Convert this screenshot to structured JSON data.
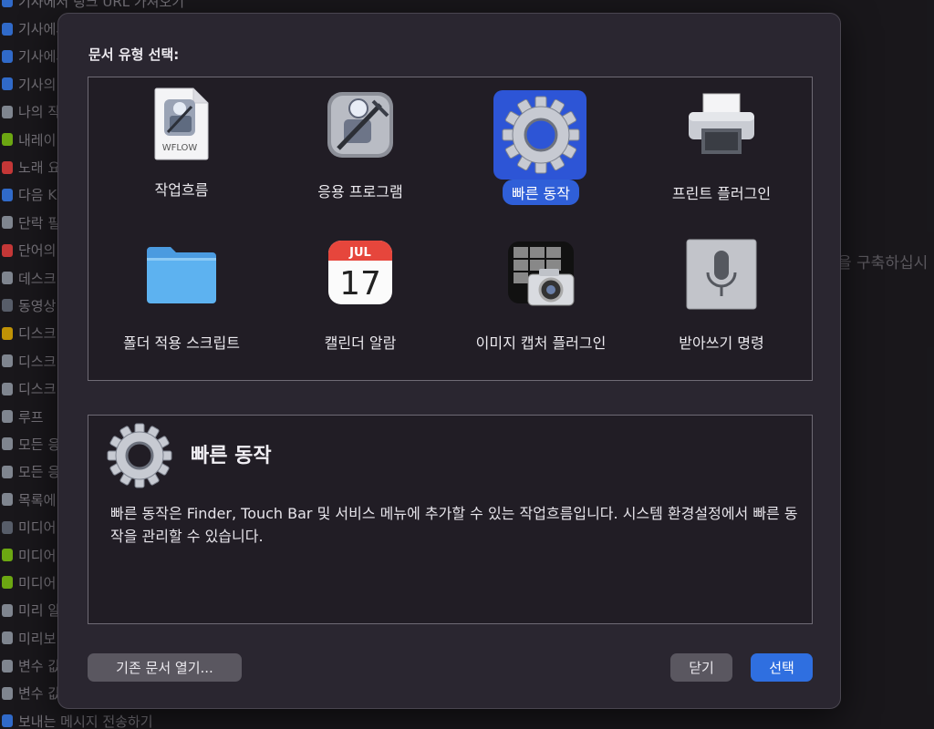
{
  "background": {
    "sidebar_items": [
      {
        "label": "기사에서 링크 URL 가져오기",
        "color": "#3b82f6"
      },
      {
        "label": "기사에서",
        "color": "#3b82f6"
      },
      {
        "label": "기사에서",
        "color": "#3b82f6"
      },
      {
        "label": "기사의",
        "color": "#3b82f6"
      },
      {
        "label": "나의 작",
        "color": "#9ca3af"
      },
      {
        "label": "내레이",
        "color": "#84cc16"
      },
      {
        "label": "노래 요",
        "color": "#ef4444"
      },
      {
        "label": "다음 K",
        "color": "#3b82f6"
      },
      {
        "label": "단락 필",
        "color": "#9ca3af"
      },
      {
        "label": "단어의",
        "color": "#ef4444"
      },
      {
        "label": "데스크",
        "color": "#9ca3af"
      },
      {
        "label": "동영상",
        "color": "#6b7280"
      },
      {
        "label": "디스크",
        "color": "#eab308"
      },
      {
        "label": "디스크",
        "color": "#9ca3af"
      },
      {
        "label": "디스크",
        "color": "#9ca3af"
      },
      {
        "label": "루프",
        "color": "#9ca3af"
      },
      {
        "label": "모든 응",
        "color": "#9ca3af"
      },
      {
        "label": "모든 응",
        "color": "#9ca3af"
      },
      {
        "label": "목록에",
        "color": "#9ca3af"
      },
      {
        "label": "미디어",
        "color": "#6b7280"
      },
      {
        "label": "미디어",
        "color": "#84cc16"
      },
      {
        "label": "미디어",
        "color": "#84cc16"
      },
      {
        "label": "미리 알",
        "color": "#9ca3af"
      },
      {
        "label": "미리보",
        "color": "#9ca3af"
      },
      {
        "label": "변수 값",
        "color": "#9ca3af"
      },
      {
        "label": "변수 값",
        "color": "#9ca3af"
      },
      {
        "label": "보내는 메시지 전송하기",
        "color": "#3b82f6"
      }
    ],
    "right_text": "을 구축하십시"
  },
  "dialog": {
    "title": "문서 유형 선택:",
    "types": [
      {
        "label": "작업흐름",
        "icon": "workflow-document-icon",
        "icon_text": "WFLOW"
      },
      {
        "label": "응용 프로그램",
        "icon": "automator-robot-icon"
      },
      {
        "label": "빠른 동작",
        "icon": "gear-icon"
      },
      {
        "label": "프린트 플러그인",
        "icon": "printer-icon"
      },
      {
        "label": "폴더 적용 스크립트",
        "icon": "folder-icon"
      },
      {
        "label": "캘린더 알람",
        "icon": "calendar-icon",
        "month": "JUL",
        "day": "17"
      },
      {
        "label": "이미지 캡처 플러그인",
        "icon": "image-capture-icon"
      },
      {
        "label": "받아쓰기 명령",
        "icon": "microphone-icon"
      }
    ],
    "selected_index": 2,
    "description": {
      "title": "빠른 동작",
      "text": "빠른 동작은 Finder, Touch Bar 및 서비스 메뉴에 추가할 수 있는 작업흐름입니다. 시스템 환경설정에서 빠른 동작을 관리할 수 있습니다."
    },
    "buttons": {
      "open_existing": "기존 문서 열기...",
      "close": "닫기",
      "choose": "선택"
    },
    "accent_color": "#2f6fe0"
  }
}
